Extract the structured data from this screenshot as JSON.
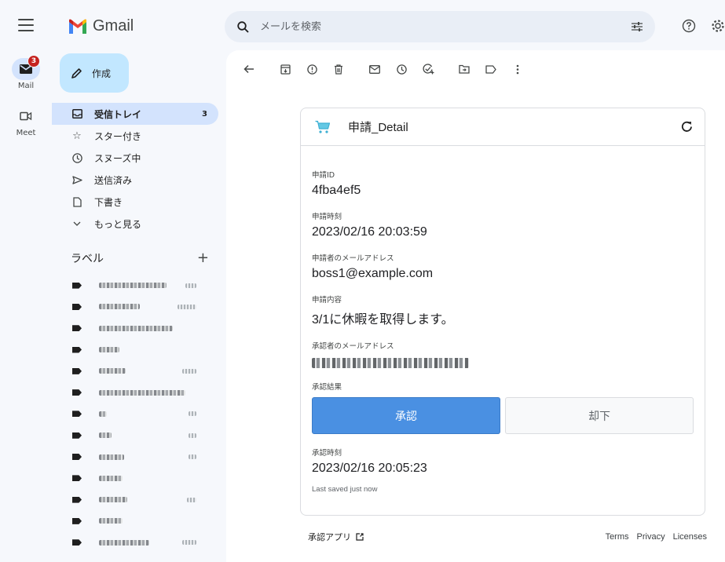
{
  "app": {
    "name": "Gmail"
  },
  "rail": {
    "mail": {
      "label": "Mail",
      "badge": "3"
    },
    "meet": {
      "label": "Meet"
    }
  },
  "search": {
    "placeholder": "メールを検索"
  },
  "compose": {
    "label": "作成"
  },
  "nav": [
    {
      "label": "受信トレイ",
      "count": "3",
      "icon": "inbox-icon"
    },
    {
      "label": "スター付き",
      "count": "",
      "icon": "star-icon"
    },
    {
      "label": "スヌーズ中",
      "count": "",
      "icon": "clock-icon"
    },
    {
      "label": "送信済み",
      "count": "",
      "icon": "send-icon"
    },
    {
      "label": "下書き",
      "count": "",
      "icon": "draft-icon"
    },
    {
      "label": "もっと見る",
      "count": "",
      "icon": "chevron-down-icon"
    }
  ],
  "labels": {
    "heading": "ラベル",
    "add": "+",
    "count_rows": 13
  },
  "card": {
    "title": "申請_Detail",
    "fields": {
      "request_id_label": "申請ID",
      "request_id": "4fba4ef5",
      "request_time_label": "申請時刻",
      "request_time": "2023/02/16 20:03:59",
      "applicant_email_label": "申請者のメールアドレス",
      "applicant_email": "boss1@example.com",
      "request_content_label": "申請内容",
      "request_content": "3/1に休暇を取得します。",
      "approver_email_label": "承認者のメールアドレス",
      "approval_result_label": "承認結果",
      "approval_time_label": "承認時刻",
      "approval_time": "2023/02/16 20:05:23"
    },
    "buttons": {
      "approve": "承認",
      "reject": "却下"
    },
    "saved_status": "Last saved just now"
  },
  "footer": {
    "app_name": "承認アプリ",
    "terms": "Terms",
    "privacy": "Privacy",
    "licenses": "Licenses"
  },
  "colors": {
    "approve_button": "#4a90e2",
    "compose": "#c2e7ff",
    "active_nav": "#d3e3fd",
    "badge": "#c5221f"
  }
}
